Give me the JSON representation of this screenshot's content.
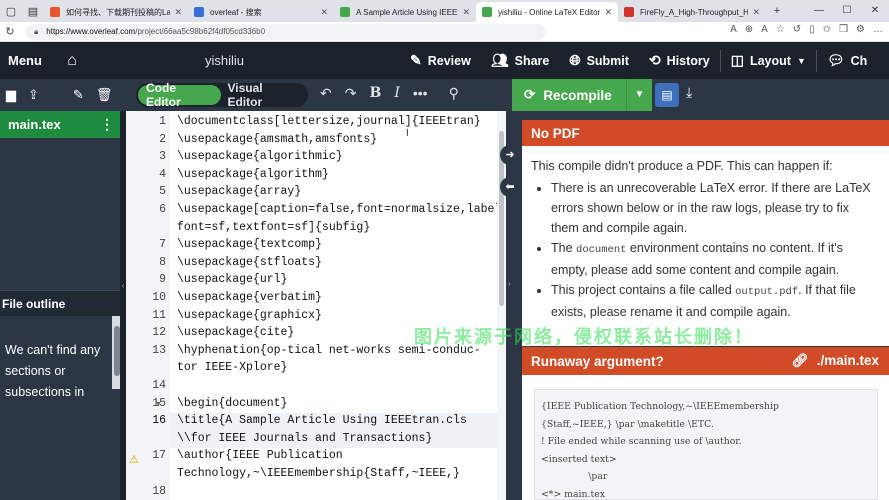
{
  "browser": {
    "tabs": [
      {
        "title": "如何寻找、下载期刊投稿的LaTeX",
        "active": false,
        "favicon_color": "#e8552e"
      },
      {
        "title": "overleaf - 搜索",
        "active": false,
        "favicon_color": "#3b6fd8"
      },
      {
        "title": "A Sample Article Using IEEEtran",
        "active": false,
        "favicon_color": "#46a84d"
      },
      {
        "title": "yishiliu - Online LaTeX Editor Ov",
        "active": true,
        "favicon_color": "#46a84d"
      },
      {
        "title": "FireFly_A_High-Throughput_Har",
        "active": false,
        "favicon_color": "#d0342c"
      }
    ],
    "url_prefix": "https://www.overleaf.com",
    "url_path": "/project/66aa5c98b62f4df05cd336b0"
  },
  "toolbar": {
    "menu": "Menu",
    "project_name": "yishiliu",
    "review": "Review",
    "share": "Share",
    "submit": "Submit",
    "history": "History",
    "layout": "Layout",
    "chat": "Ch"
  },
  "editor_bar": {
    "code_editor": "Code Editor",
    "visual_editor": "Visual Editor",
    "recompile": "Recompile"
  },
  "file_tree": {
    "main_file": "main.tex",
    "outline_title": "File outline",
    "outline_text": "We can't find any sections or subsections in"
  },
  "code": {
    "lines": [
      {
        "no": "1",
        "text": "\\documentclass[lettersize,journal]{IEEEtran}"
      },
      {
        "no": "2",
        "text": "\\usepackage{amsmath,amsfonts}"
      },
      {
        "no": "3",
        "text": "\\usepackage{algorithmic}"
      },
      {
        "no": "4",
        "text": "\\usepackage{algorithm}"
      },
      {
        "no": "5",
        "text": "\\usepackage{array}"
      },
      {
        "no": "6",
        "text": "\\usepackage[caption=false,font=normalsize,label"
      },
      {
        "no": "",
        "text": "font=sf,textfont=sf]{subfig}"
      },
      {
        "no": "7",
        "text": "\\usepackage{textcomp}"
      },
      {
        "no": "8",
        "text": "\\usepackage{stfloats}"
      },
      {
        "no": "9",
        "text": "\\usepackage{url}"
      },
      {
        "no": "10",
        "text": "\\usepackage{verbatim}"
      },
      {
        "no": "11",
        "text": "\\usepackage{graphicx}"
      },
      {
        "no": "12",
        "text": "\\usepackage{cite}"
      },
      {
        "no": "13",
        "text": "\\hyphenation{op-tical net-works semi-conduc-"
      },
      {
        "no": "",
        "text": "tor IEEE-Xplore}"
      },
      {
        "no": "14",
        "text": ""
      },
      {
        "no": "15",
        "text": "\\begin{document}"
      },
      {
        "no": "16",
        "text": "\\title{A Sample Article Using IEEEtran.cls"
      },
      {
        "no": "",
        "text": "\\\\for IEEE Journals and Transactions}"
      },
      {
        "no": "17",
        "text": "\\author{IEEE Publication"
      },
      {
        "no": "",
        "text": "Technology,~\\IEEEmembership{Staff,~IEEE,}"
      },
      {
        "no": "18",
        "text": ""
      }
    ]
  },
  "pdf_panel": {
    "no_pdf_title": "No PDF",
    "intro": "This compile didn't produce a PDF. This can happen if:",
    "bullet1": "There is an unrecoverable LaTeX error. If there are LaTeX errors shown below or in the raw logs, please try to fix them and compile again.",
    "bullet2_a": "The ",
    "bullet2_code": "document",
    "bullet2_b": " environment contains no content. If it's empty, please add some content and compile again.",
    "bullet3_a": "This project contains a file called ",
    "bullet3_code": "output.pdf",
    "bullet3_b": ". If that file exists, please rename it and compile again.",
    "runaway_title": "Runaway argument?",
    "runaway_file": "./main.tex",
    "log": "{IEEE Publication Technology,~\\IEEEmembership\n{Staff,~IEEE,} \\par \\maketitle \\ETC.\n! File ended while scanning use of \\author.\n<inserted text>\n                \\par\n<*> main.tex"
  },
  "watermark": "图片来源于网络，侵权联系站长删除！"
}
